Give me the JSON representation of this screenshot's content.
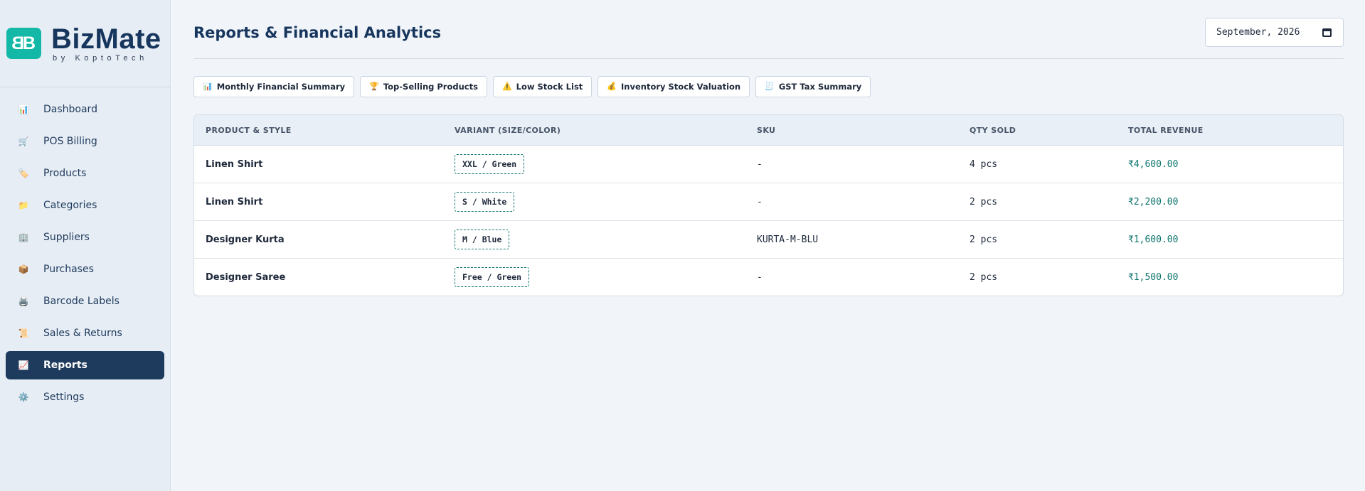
{
  "brand": {
    "name": "BizMate",
    "sub": "by KoptoTech",
    "logo_glyph": "B"
  },
  "sidebar": {
    "items": [
      {
        "label": "Dashboard",
        "icon": "📊",
        "icon_name": "bar-chart-icon",
        "active": false
      },
      {
        "label": "POS Billing",
        "icon": "🛒",
        "icon_name": "cart-icon",
        "active": false
      },
      {
        "label": "Products",
        "icon": "🏷️",
        "icon_name": "tag-icon",
        "active": false
      },
      {
        "label": "Categories",
        "icon": "📁",
        "icon_name": "folder-icon",
        "active": false
      },
      {
        "label": "Suppliers",
        "icon": "🏢",
        "icon_name": "building-icon",
        "active": false
      },
      {
        "label": "Purchases",
        "icon": "📦",
        "icon_name": "package-icon",
        "active": false
      },
      {
        "label": "Barcode Labels",
        "icon": "🖨️",
        "icon_name": "printer-icon",
        "active": false
      },
      {
        "label": "Sales & Returns",
        "icon": "📜",
        "icon_name": "scroll-icon",
        "active": false
      },
      {
        "label": "Reports",
        "icon": "📈",
        "icon_name": "trend-chart-icon",
        "active": true
      },
      {
        "label": "Settings",
        "icon": "⚙️",
        "icon_name": "gear-icon",
        "active": false
      }
    ]
  },
  "header": {
    "title": "Reports & Financial Analytics",
    "month_value": "September, 2026"
  },
  "tabs": [
    {
      "label": "Monthly Financial Summary",
      "icon": "📊",
      "icon_name": "bar-chart-icon"
    },
    {
      "label": "Top-Selling Products",
      "icon": "🏆",
      "icon_name": "trophy-icon"
    },
    {
      "label": "Low Stock List",
      "icon": "⚠️",
      "icon_name": "warning-icon"
    },
    {
      "label": "Inventory Stock Valuation",
      "icon": "💰",
      "icon_name": "money-bag-icon"
    },
    {
      "label": "GST Tax Summary",
      "icon": "🧾",
      "icon_name": "receipt-icon"
    }
  ],
  "table": {
    "headers": [
      "PRODUCT & STYLE",
      "VARIANT (SIZE/COLOR)",
      "SKU",
      "QTY SOLD",
      "TOTAL REVENUE"
    ],
    "rows": [
      {
        "product": "Linen Shirt",
        "variant": "XXL / Green",
        "sku": "-",
        "qty": "4 pcs",
        "revenue": "₹4,600.00"
      },
      {
        "product": "Linen Shirt",
        "variant": "S / White",
        "sku": "-",
        "qty": "2 pcs",
        "revenue": "₹2,200.00"
      },
      {
        "product": "Designer Kurta",
        "variant": "M / Blue",
        "sku": "KURTA-M-BLU",
        "qty": "2 pcs",
        "revenue": "₹1,600.00"
      },
      {
        "product": "Designer Saree",
        "variant": "Free / Green",
        "sku": "-",
        "qty": "2 pcs",
        "revenue": "₹1,500.00"
      }
    ]
  },
  "colors": {
    "accent_teal": "#14b8a6",
    "revenue_text": "#0f766e",
    "active_nav_bg": "#1e3a5c",
    "brand_navy": "#17365d"
  }
}
